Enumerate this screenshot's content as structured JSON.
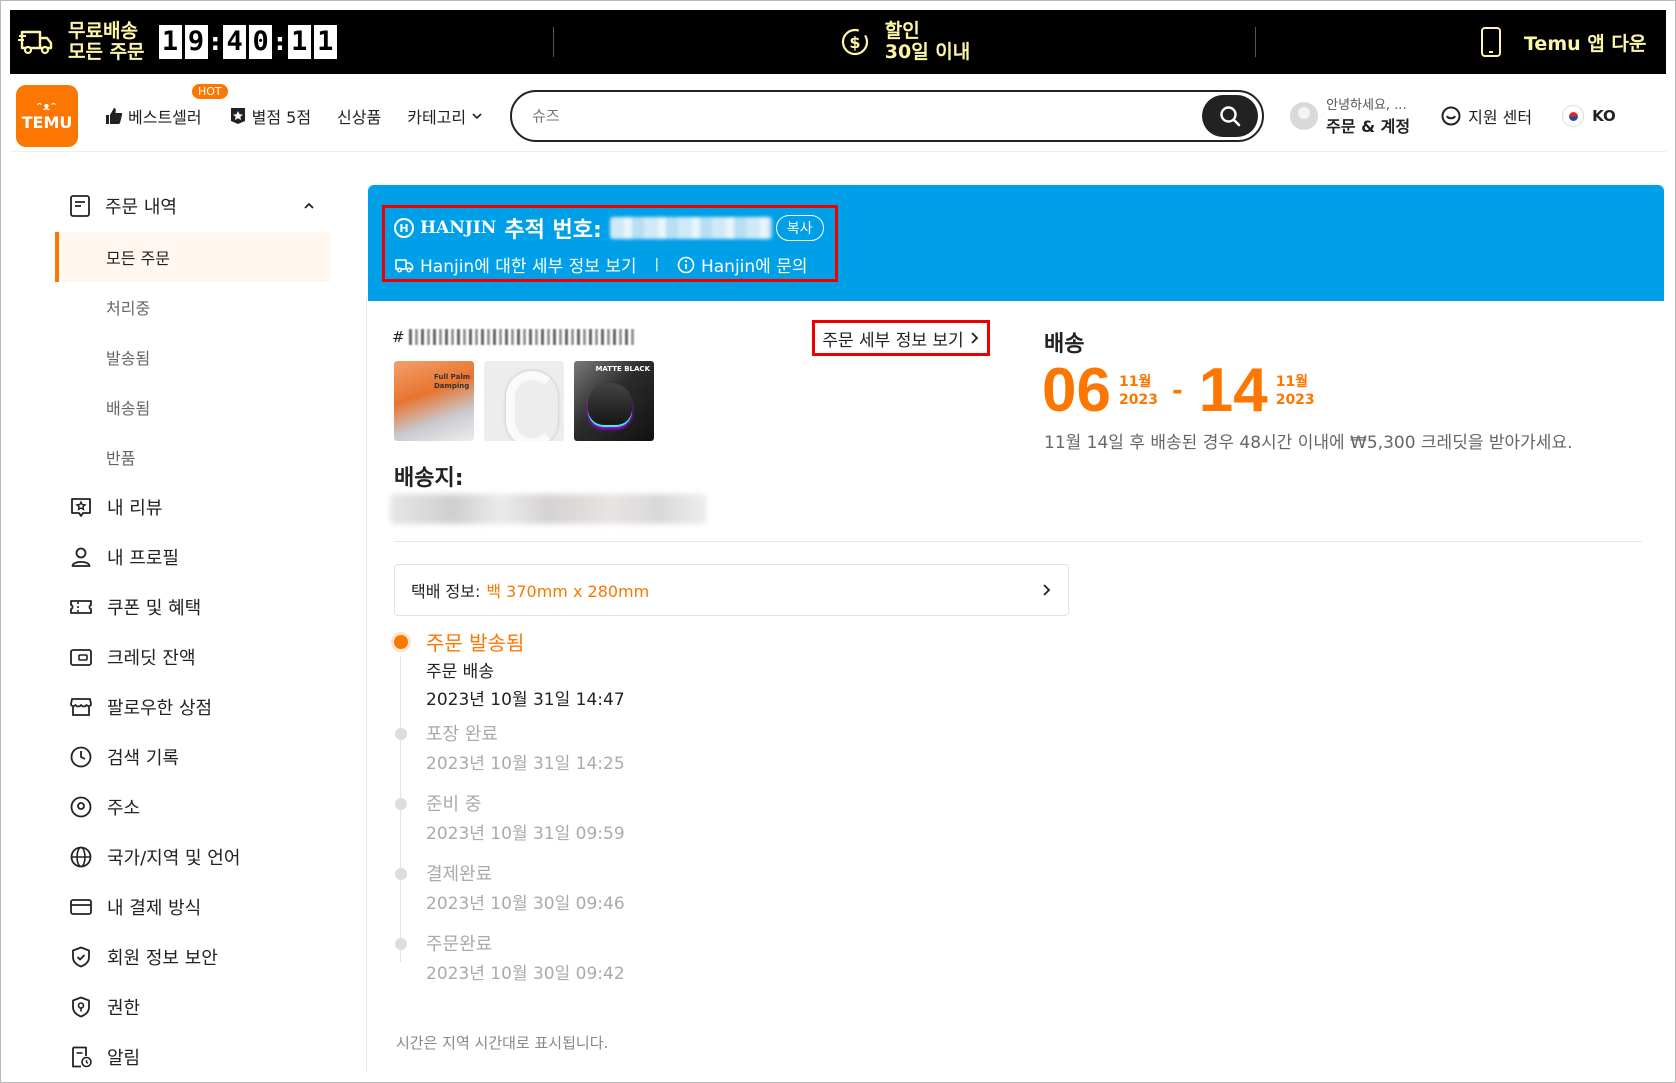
{
  "promo": {
    "free_shipping": "무료배송",
    "all_orders": "모든 주문",
    "timer": [
      "1",
      "9",
      ":",
      "4",
      "0",
      ":",
      "1",
      "1"
    ],
    "discount": "할인",
    "within_30": "30일 이내",
    "app_download": "Temu 앱 다운"
  },
  "header": {
    "logo_top": "ᵔᴥᵔ",
    "logo_text": "TEMU",
    "best_seller": "베스트셀러",
    "hot_badge": "HOT",
    "five_star": "별점 5점",
    "new_arrivals": "신상품",
    "categories": "카테고리",
    "search_placeholder": "슈즈",
    "greeting": "안녕하세요, ...",
    "orders_account": "주문 & 계정",
    "support": "지원 센터",
    "lang": "KO"
  },
  "sidebar": {
    "orders": "주문 내역",
    "sub": [
      "모든 주문",
      "처리중",
      "발송됨",
      "배송됨",
      "반품"
    ],
    "items": [
      "내 리뷰",
      "내 프로필",
      "쿠폰 및 혜택",
      "크레딧 잔액",
      "팔로우한 상점",
      "검색 기록",
      "주소",
      "국가/지역 및 언어",
      "내 결제 방식",
      "회원 정보 보안",
      "권한",
      "알림"
    ]
  },
  "tracking": {
    "carrier": "HANJIN",
    "label": "추적 번호:",
    "copy": "복사",
    "details_link": "Hanjin에 대한 세부 정보 보기",
    "separator": "|",
    "contact_link": "Hanjin에 문의"
  },
  "order": {
    "hash": "#",
    "details_link": "주문 세부 정보 보기",
    "address_title": "배송지:"
  },
  "delivery": {
    "title": "배송",
    "start_day": "06",
    "start_month": "11월",
    "start_year": "2023",
    "dash": "-",
    "end_day": "14",
    "end_month": "11월",
    "end_year": "2023",
    "note": "11월 14일 후 배송된 경우 48시간 이내에 ₩5,300 크레딧을 받아가세요."
  },
  "parcel": {
    "label": "택배 정보:",
    "value": "백 370mm x 280mm"
  },
  "timeline": {
    "steps": [
      {
        "title": "주문 발송됨",
        "sub": "주문 배송",
        "time": "2023년 10월 31일 14:47"
      },
      {
        "title": "포장 완료",
        "time": "2023년 10월 31일 14:25"
      },
      {
        "title": "준비 중",
        "time": "2023년 10월 31일 09:59"
      },
      {
        "title": "결제완료",
        "time": "2023년 10월 30일 09:46"
      },
      {
        "title": "주문완료",
        "time": "2023년 10월 30일 09:42"
      }
    ],
    "note": "시간은 지역 시간대로 표시됩니다."
  },
  "colors": {
    "brand": "#fb7701",
    "tracking_banner": "#00a0e9",
    "promo_text": "#fff7a8",
    "highlight_box": "#e00000"
  }
}
